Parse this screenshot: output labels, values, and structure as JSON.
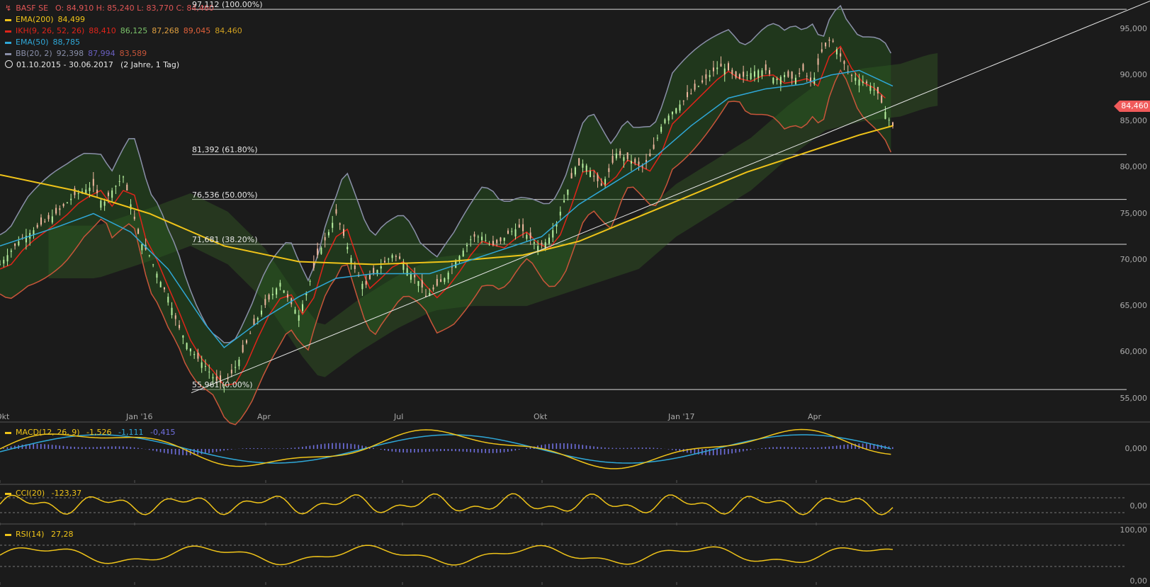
{
  "header": {
    "symbol": "BASF SE",
    "ohlc": "O: 84,910  H: 85,240  L: 83,770  C: 84,460",
    "period": "01.10.2015 - 30.06.2017",
    "period_note": "(2 Jahre, 1 Tag)"
  },
  "indicators": [
    {
      "label": "EMA(200)",
      "values": [
        "84,499"
      ],
      "color": "#f0c419",
      "value_colors": [
        "#f0c419"
      ]
    },
    {
      "label": "IKH(9, 26, 52, 26)",
      "values": [
        "88,410",
        "86,125",
        "87,268",
        "89,045",
        "84,460"
      ],
      "color": "#e0241a",
      "value_colors": [
        "#e0241a",
        "#7bc36a",
        "#e0a040",
        "#e0603a",
        "#d0a020"
      ]
    },
    {
      "label": "EMA(50)",
      "values": [
        "88,785"
      ],
      "color": "#2fa8d8",
      "value_colors": [
        "#2fa8d8"
      ]
    },
    {
      "label": "BB(20, 2)",
      "values": [
        "92,398",
        "87,994",
        "83,589"
      ],
      "color": "#8a8fa8",
      "value_colors": [
        "#8a8fa8",
        "#6a60c0",
        "#c8553a"
      ]
    }
  ],
  "price_badge": "84,460",
  "fib_levels": [
    {
      "label": "97,112 (100.00%)",
      "value": 97.112
    },
    {
      "label": "81,392 (61.80%)",
      "value": 81.392
    },
    {
      "label": "76,536 (50.00%)",
      "value": 76.536
    },
    {
      "label": "71,681 (38.20%)",
      "value": 71.681
    },
    {
      "label": "55,961 (0.00%)",
      "value": 55.961
    }
  ],
  "y_ticks": [
    "95,000",
    "90,000",
    "85,000",
    "80,000",
    "75,000",
    "70,000",
    "65,000",
    "60,000",
    "55,000"
  ],
  "x_ticks": [
    "Okt",
    "Jan '16",
    "Apr",
    "Jul",
    "Okt",
    "Jan '17",
    "Apr"
  ],
  "panels": {
    "macd": {
      "label": "MACD(12, 26, 9)",
      "values": [
        "-1,526",
        "-1,111",
        "-0,415"
      ],
      "value_colors": [
        "#f0c419",
        "#2fa8d8",
        "#7070e0"
      ],
      "y_tick": "0,000"
    },
    "cci": {
      "label": "CCI(20)",
      "values": [
        "-123,37"
      ],
      "y_tick": "0,00"
    },
    "rsi": {
      "label": "RSI(14)",
      "values": [
        "27,28"
      ],
      "y_ticks": [
        "100,00",
        "0,00"
      ]
    }
  },
  "chart_data": {
    "type": "line",
    "title": "BASF SE",
    "x_range": [
      "2015-10-01",
      "2017-06-30"
    ],
    "ylim": [
      55,
      97.5
    ],
    "series": [
      {
        "name": "BASF SE",
        "values": [
          [
            0,
            69.5
          ],
          [
            10,
            72
          ],
          [
            20,
            73.5
          ],
          [
            30,
            75
          ],
          [
            40,
            77
          ],
          [
            50,
            78
          ],
          [
            55,
            76
          ],
          [
            60,
            77.5
          ],
          [
            66,
            79
          ],
          [
            70,
            76
          ],
          [
            75,
            72
          ],
          [
            80,
            70.5
          ],
          [
            85,
            68
          ],
          [
            90,
            66
          ],
          [
            95,
            63
          ],
          [
            100,
            61
          ],
          [
            105,
            59.5
          ],
          [
            110,
            58.5
          ],
          [
            115,
            57
          ],
          [
            120,
            56.5
          ],
          [
            125,
            58
          ],
          [
            130,
            60
          ],
          [
            135,
            62.5
          ],
          [
            140,
            64.5
          ],
          [
            145,
            66
          ],
          [
            150,
            67.5
          ],
          [
            155,
            65.5
          ],
          [
            160,
            64
          ],
          [
            165,
            67
          ],
          [
            170,
            70.5
          ],
          [
            175,
            72.5
          ],
          [
            180,
            75
          ],
          [
            185,
            72
          ],
          [
            190,
            69
          ],
          [
            195,
            67
          ],
          [
            200,
            68.5
          ],
          [
            205,
            69.5
          ],
          [
            210,
            70.5
          ],
          [
            215,
            70
          ],
          [
            220,
            68.5
          ],
          [
            225,
            67.5
          ],
          [
            228,
            66
          ],
          [
            233,
            67
          ],
          [
            238,
            68
          ],
          [
            243,
            69.5
          ],
          [
            248,
            71
          ],
          [
            253,
            72.5
          ],
          [
            258,
            72.5
          ],
          [
            263,
            71.5
          ],
          [
            268,
            72
          ],
          [
            273,
            73
          ],
          [
            278,
            73.5
          ],
          [
            283,
            72.5
          ],
          [
            288,
            71.5
          ],
          [
            293,
            72
          ],
          [
            298,
            74
          ],
          [
            303,
            77
          ],
          [
            308,
            80
          ],
          [
            313,
            80.5
          ],
          [
            318,
            79
          ],
          [
            322,
            78
          ],
          [
            326,
            79.5
          ],
          [
            330,
            81.5
          ],
          [
            335,
            81
          ],
          [
            340,
            80.5
          ],
          [
            345,
            80
          ],
          [
            350,
            82
          ],
          [
            355,
            85
          ],
          [
            360,
            86
          ],
          [
            365,
            87
          ],
          [
            370,
            88
          ],
          [
            375,
            89
          ],
          [
            380,
            90
          ],
          [
            385,
            91
          ],
          [
            390,
            90.5
          ],
          [
            395,
            89.5
          ],
          [
            400,
            90
          ],
          [
            405,
            90.5
          ],
          [
            410,
            90.5
          ],
          [
            415,
            89.5
          ],
          [
            420,
            90
          ],
          [
            425,
            89.5
          ],
          [
            430,
            90.5
          ],
          [
            435,
            89
          ],
          [
            440,
            92.5
          ],
          [
            445,
            94
          ],
          [
            450,
            92
          ],
          [
            455,
            90
          ],
          [
            460,
            89.5
          ],
          [
            465,
            89
          ],
          [
            470,
            88
          ],
          [
            475,
            85.5
          ],
          [
            478,
            84.46
          ]
        ]
      },
      {
        "name": "EMA(200)",
        "values": [
          [
            0,
            79.2
          ],
          [
            40,
            77.5
          ],
          [
            80,
            75
          ],
          [
            120,
            71.5
          ],
          [
            160,
            69.8
          ],
          [
            200,
            69.5
          ],
          [
            240,
            69.8
          ],
          [
            280,
            70.5
          ],
          [
            310,
            72
          ],
          [
            340,
            74.5
          ],
          [
            370,
            77
          ],
          [
            400,
            79.5
          ],
          [
            430,
            81.5
          ],
          [
            460,
            83.5
          ],
          [
            478,
            84.5
          ]
        ]
      },
      {
        "name": "EMA(50)",
        "values": [
          [
            0,
            71.5
          ],
          [
            30,
            73.5
          ],
          [
            50,
            75
          ],
          [
            70,
            73
          ],
          [
            90,
            69
          ],
          [
            110,
            63
          ],
          [
            120,
            60.5
          ],
          [
            140,
            63.5
          ],
          [
            160,
            66
          ],
          [
            180,
            68
          ],
          [
            200,
            68.5
          ],
          [
            230,
            68.5
          ],
          [
            260,
            70.5
          ],
          [
            290,
            72.5
          ],
          [
            310,
            76
          ],
          [
            330,
            78.5
          ],
          [
            350,
            81
          ],
          [
            370,
            84.5
          ],
          [
            390,
            87.5
          ],
          [
            410,
            88.5
          ],
          [
            430,
            89
          ],
          [
            445,
            90
          ],
          [
            460,
            90.5
          ],
          [
            478,
            88.8
          ]
        ]
      }
    ]
  }
}
